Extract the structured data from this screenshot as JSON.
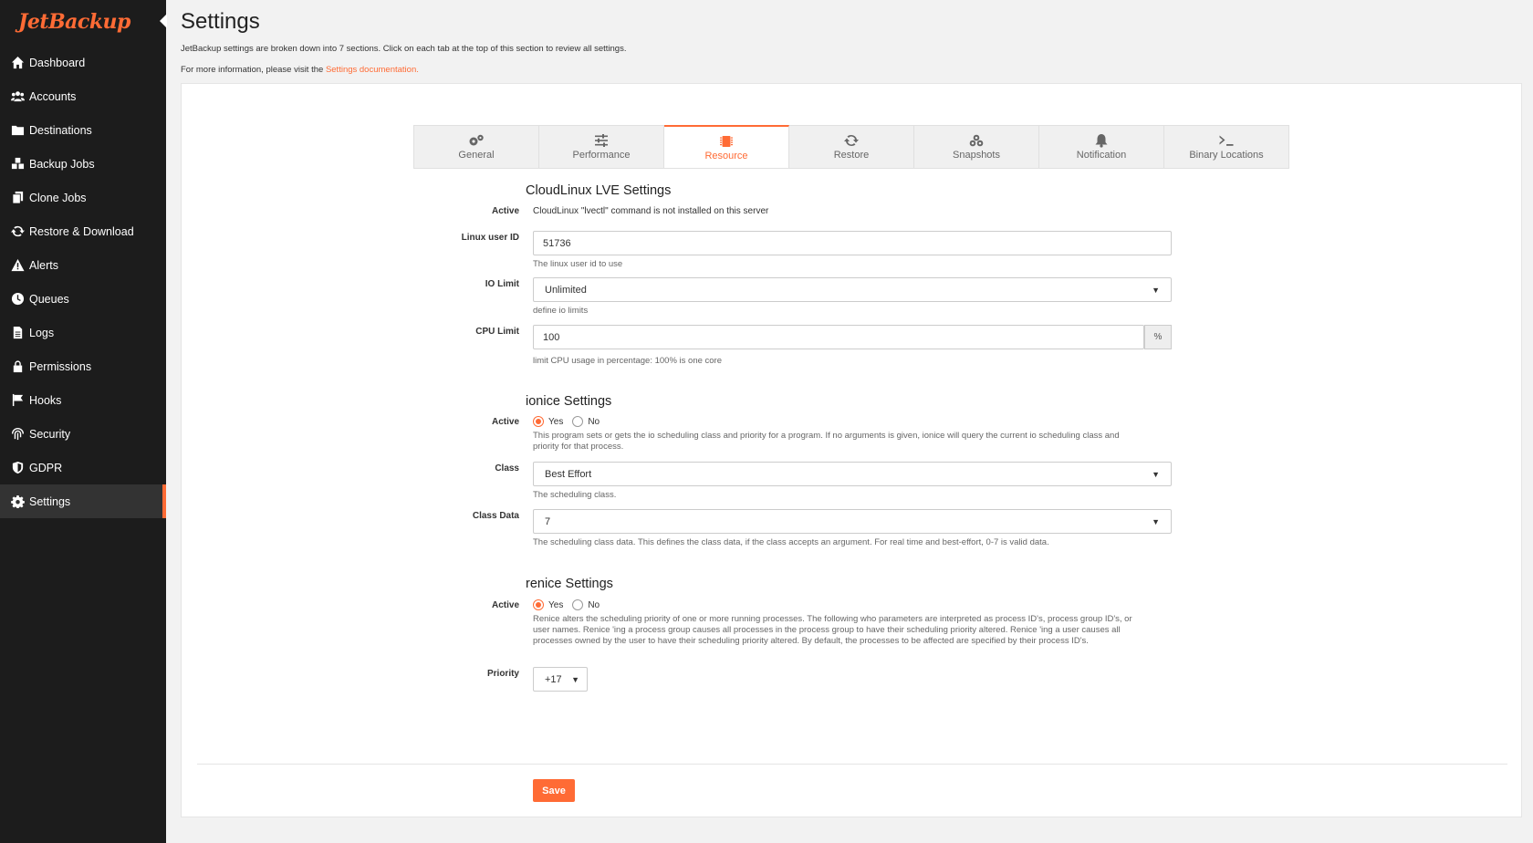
{
  "brand": {
    "name": "JetBackup",
    "accent": "#ff6b35"
  },
  "sidebar": {
    "items": [
      {
        "label": "Dashboard",
        "icon": "home-icon"
      },
      {
        "label": "Accounts",
        "icon": "users-icon"
      },
      {
        "label": "Destinations",
        "icon": "folder-icon"
      },
      {
        "label": "Backup Jobs",
        "icon": "cubes-icon"
      },
      {
        "label": "Clone Jobs",
        "icon": "copy-icon"
      },
      {
        "label": "Restore & Download",
        "icon": "refresh-icon"
      },
      {
        "label": "Alerts",
        "icon": "warning-icon"
      },
      {
        "label": "Queues",
        "icon": "clock-icon"
      },
      {
        "label": "Logs",
        "icon": "file-icon"
      },
      {
        "label": "Permissions",
        "icon": "lock-icon"
      },
      {
        "label": "Hooks",
        "icon": "flag-icon"
      },
      {
        "label": "Security",
        "icon": "fingerprint-icon"
      },
      {
        "label": "GDPR",
        "icon": "shield-icon"
      },
      {
        "label": "Settings",
        "icon": "gear-icon",
        "active": true
      }
    ]
  },
  "header": {
    "title": "Settings",
    "intro": "JetBackup settings are broken down into 7 sections. Click on each tab at the top of this section to review all settings.",
    "more_prefix": "For more information, please visit the ",
    "more_link": "Settings documentation."
  },
  "tabs": [
    {
      "label": "General",
      "icon": "gears-icon"
    },
    {
      "label": "Performance",
      "icon": "sliders-icon"
    },
    {
      "label": "Resource",
      "icon": "chip-icon",
      "active": true
    },
    {
      "label": "Restore",
      "icon": "refresh-icon"
    },
    {
      "label": "Snapshots",
      "icon": "cubes-icon"
    },
    {
      "label": "Notification",
      "icon": "bell-icon"
    },
    {
      "label": "Binary Locations",
      "icon": "terminal-icon"
    }
  ],
  "cloudlinux": {
    "title": "CloudLinux LVE Settings",
    "active_label": "Active",
    "active_value": "CloudLinux \"lvectl\" command is not installed on this server",
    "user_id_label": "Linux user ID",
    "user_id_value": "51736",
    "user_id_help": "The linux user id to use",
    "io_label": "IO Limit",
    "io_value": "Unlimited",
    "io_help": "define io limits",
    "cpu_label": "CPU Limit",
    "cpu_value": "100",
    "cpu_addon": "%",
    "cpu_help": "limit CPU usage in percentage: 100% is one core"
  },
  "ionice": {
    "title": "ionice Settings",
    "active_label": "Active",
    "yes": "Yes",
    "no": "No",
    "selected": "Yes",
    "help": "This program sets or gets the io scheduling class and priority for a program. If no arguments is given, ionice will query the current io scheduling class and priority for that process.",
    "class_label": "Class",
    "class_value": "Best Effort",
    "class_help": "The scheduling class.",
    "class_data_label": "Class Data",
    "class_data_value": "7",
    "class_data_help": "The scheduling class data. This defines the class data, if the class accepts an argument. For real time and best-effort, 0-7 is valid data."
  },
  "renice": {
    "title": "renice Settings",
    "active_label": "Active",
    "yes": "Yes",
    "no": "No",
    "selected": "Yes",
    "help": "Renice alters the scheduling priority of one or more running processes. The following who parameters are interpreted as process ID's, process group ID's, or user names. Renice 'ing a process group causes all processes in the process group to have their scheduling priority altered. Renice 'ing a user causes all processes owned by the user to have their scheduling priority altered. By default, the processes to be affected are specified by their process ID's.",
    "priority_label": "Priority",
    "priority_value": "+17"
  },
  "actions": {
    "save": "Save"
  }
}
